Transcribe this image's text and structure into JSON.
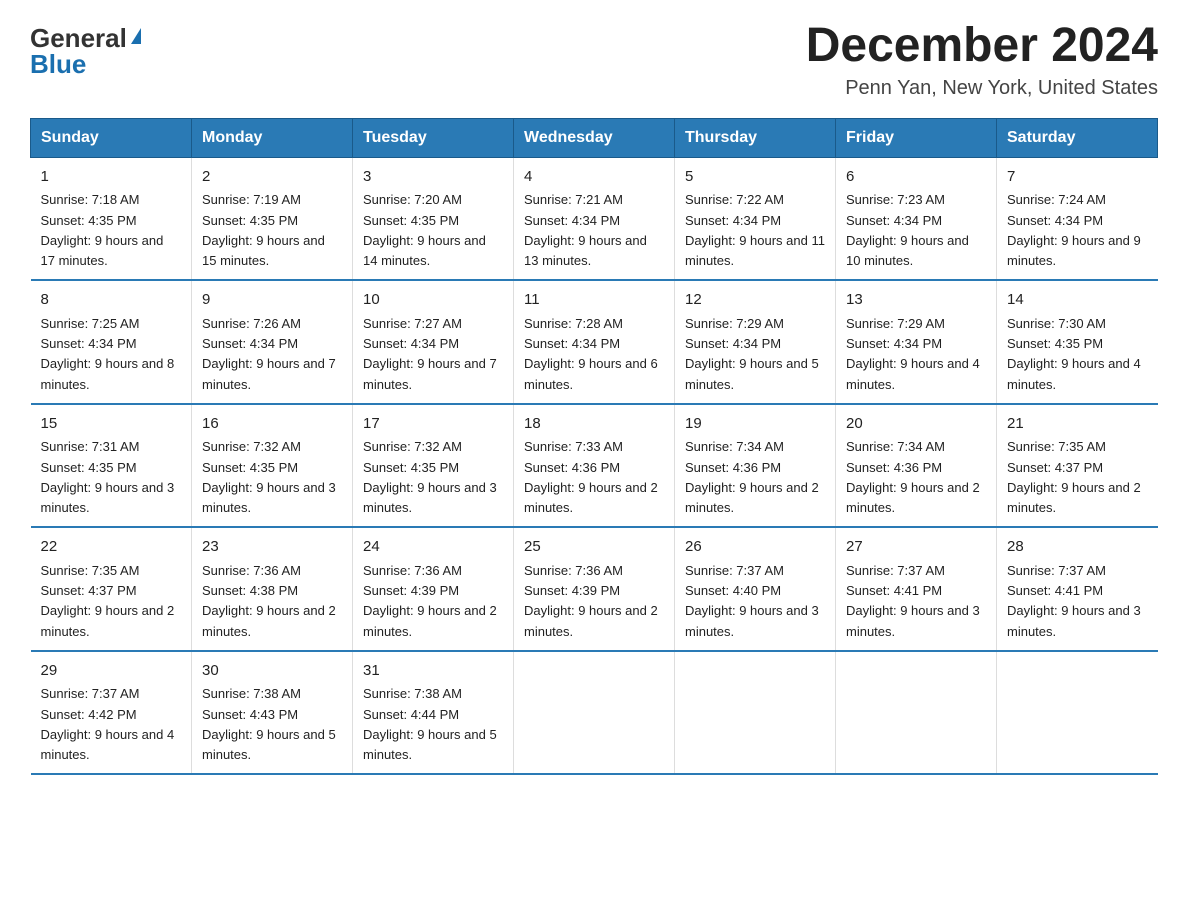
{
  "header": {
    "logo_general": "General",
    "logo_blue": "Blue",
    "month_title": "December 2024",
    "location": "Penn Yan, New York, United States"
  },
  "days_of_week": [
    "Sunday",
    "Monday",
    "Tuesday",
    "Wednesday",
    "Thursday",
    "Friday",
    "Saturday"
  ],
  "weeks": [
    [
      {
        "day": "1",
        "sunrise": "7:18 AM",
        "sunset": "4:35 PM",
        "daylight": "9 hours and 17 minutes."
      },
      {
        "day": "2",
        "sunrise": "7:19 AM",
        "sunset": "4:35 PM",
        "daylight": "9 hours and 15 minutes."
      },
      {
        "day": "3",
        "sunrise": "7:20 AM",
        "sunset": "4:35 PM",
        "daylight": "9 hours and 14 minutes."
      },
      {
        "day": "4",
        "sunrise": "7:21 AM",
        "sunset": "4:34 PM",
        "daylight": "9 hours and 13 minutes."
      },
      {
        "day": "5",
        "sunrise": "7:22 AM",
        "sunset": "4:34 PM",
        "daylight": "9 hours and 11 minutes."
      },
      {
        "day": "6",
        "sunrise": "7:23 AM",
        "sunset": "4:34 PM",
        "daylight": "9 hours and 10 minutes."
      },
      {
        "day": "7",
        "sunrise": "7:24 AM",
        "sunset": "4:34 PM",
        "daylight": "9 hours and 9 minutes."
      }
    ],
    [
      {
        "day": "8",
        "sunrise": "7:25 AM",
        "sunset": "4:34 PM",
        "daylight": "9 hours and 8 minutes."
      },
      {
        "day": "9",
        "sunrise": "7:26 AM",
        "sunset": "4:34 PM",
        "daylight": "9 hours and 7 minutes."
      },
      {
        "day": "10",
        "sunrise": "7:27 AM",
        "sunset": "4:34 PM",
        "daylight": "9 hours and 7 minutes."
      },
      {
        "day": "11",
        "sunrise": "7:28 AM",
        "sunset": "4:34 PM",
        "daylight": "9 hours and 6 minutes."
      },
      {
        "day": "12",
        "sunrise": "7:29 AM",
        "sunset": "4:34 PM",
        "daylight": "9 hours and 5 minutes."
      },
      {
        "day": "13",
        "sunrise": "7:29 AM",
        "sunset": "4:34 PM",
        "daylight": "9 hours and 4 minutes."
      },
      {
        "day": "14",
        "sunrise": "7:30 AM",
        "sunset": "4:35 PM",
        "daylight": "9 hours and 4 minutes."
      }
    ],
    [
      {
        "day": "15",
        "sunrise": "7:31 AM",
        "sunset": "4:35 PM",
        "daylight": "9 hours and 3 minutes."
      },
      {
        "day": "16",
        "sunrise": "7:32 AM",
        "sunset": "4:35 PM",
        "daylight": "9 hours and 3 minutes."
      },
      {
        "day": "17",
        "sunrise": "7:32 AM",
        "sunset": "4:35 PM",
        "daylight": "9 hours and 3 minutes."
      },
      {
        "day": "18",
        "sunrise": "7:33 AM",
        "sunset": "4:36 PM",
        "daylight": "9 hours and 2 minutes."
      },
      {
        "day": "19",
        "sunrise": "7:34 AM",
        "sunset": "4:36 PM",
        "daylight": "9 hours and 2 minutes."
      },
      {
        "day": "20",
        "sunrise": "7:34 AM",
        "sunset": "4:36 PM",
        "daylight": "9 hours and 2 minutes."
      },
      {
        "day": "21",
        "sunrise": "7:35 AM",
        "sunset": "4:37 PM",
        "daylight": "9 hours and 2 minutes."
      }
    ],
    [
      {
        "day": "22",
        "sunrise": "7:35 AM",
        "sunset": "4:37 PM",
        "daylight": "9 hours and 2 minutes."
      },
      {
        "day": "23",
        "sunrise": "7:36 AM",
        "sunset": "4:38 PM",
        "daylight": "9 hours and 2 minutes."
      },
      {
        "day": "24",
        "sunrise": "7:36 AM",
        "sunset": "4:39 PM",
        "daylight": "9 hours and 2 minutes."
      },
      {
        "day": "25",
        "sunrise": "7:36 AM",
        "sunset": "4:39 PM",
        "daylight": "9 hours and 2 minutes."
      },
      {
        "day": "26",
        "sunrise": "7:37 AM",
        "sunset": "4:40 PM",
        "daylight": "9 hours and 3 minutes."
      },
      {
        "day": "27",
        "sunrise": "7:37 AM",
        "sunset": "4:41 PM",
        "daylight": "9 hours and 3 minutes."
      },
      {
        "day": "28",
        "sunrise": "7:37 AM",
        "sunset": "4:41 PM",
        "daylight": "9 hours and 3 minutes."
      }
    ],
    [
      {
        "day": "29",
        "sunrise": "7:37 AM",
        "sunset": "4:42 PM",
        "daylight": "9 hours and 4 minutes."
      },
      {
        "day": "30",
        "sunrise": "7:38 AM",
        "sunset": "4:43 PM",
        "daylight": "9 hours and 5 minutes."
      },
      {
        "day": "31",
        "sunrise": "7:38 AM",
        "sunset": "4:44 PM",
        "daylight": "9 hours and 5 minutes."
      },
      null,
      null,
      null,
      null
    ]
  ]
}
